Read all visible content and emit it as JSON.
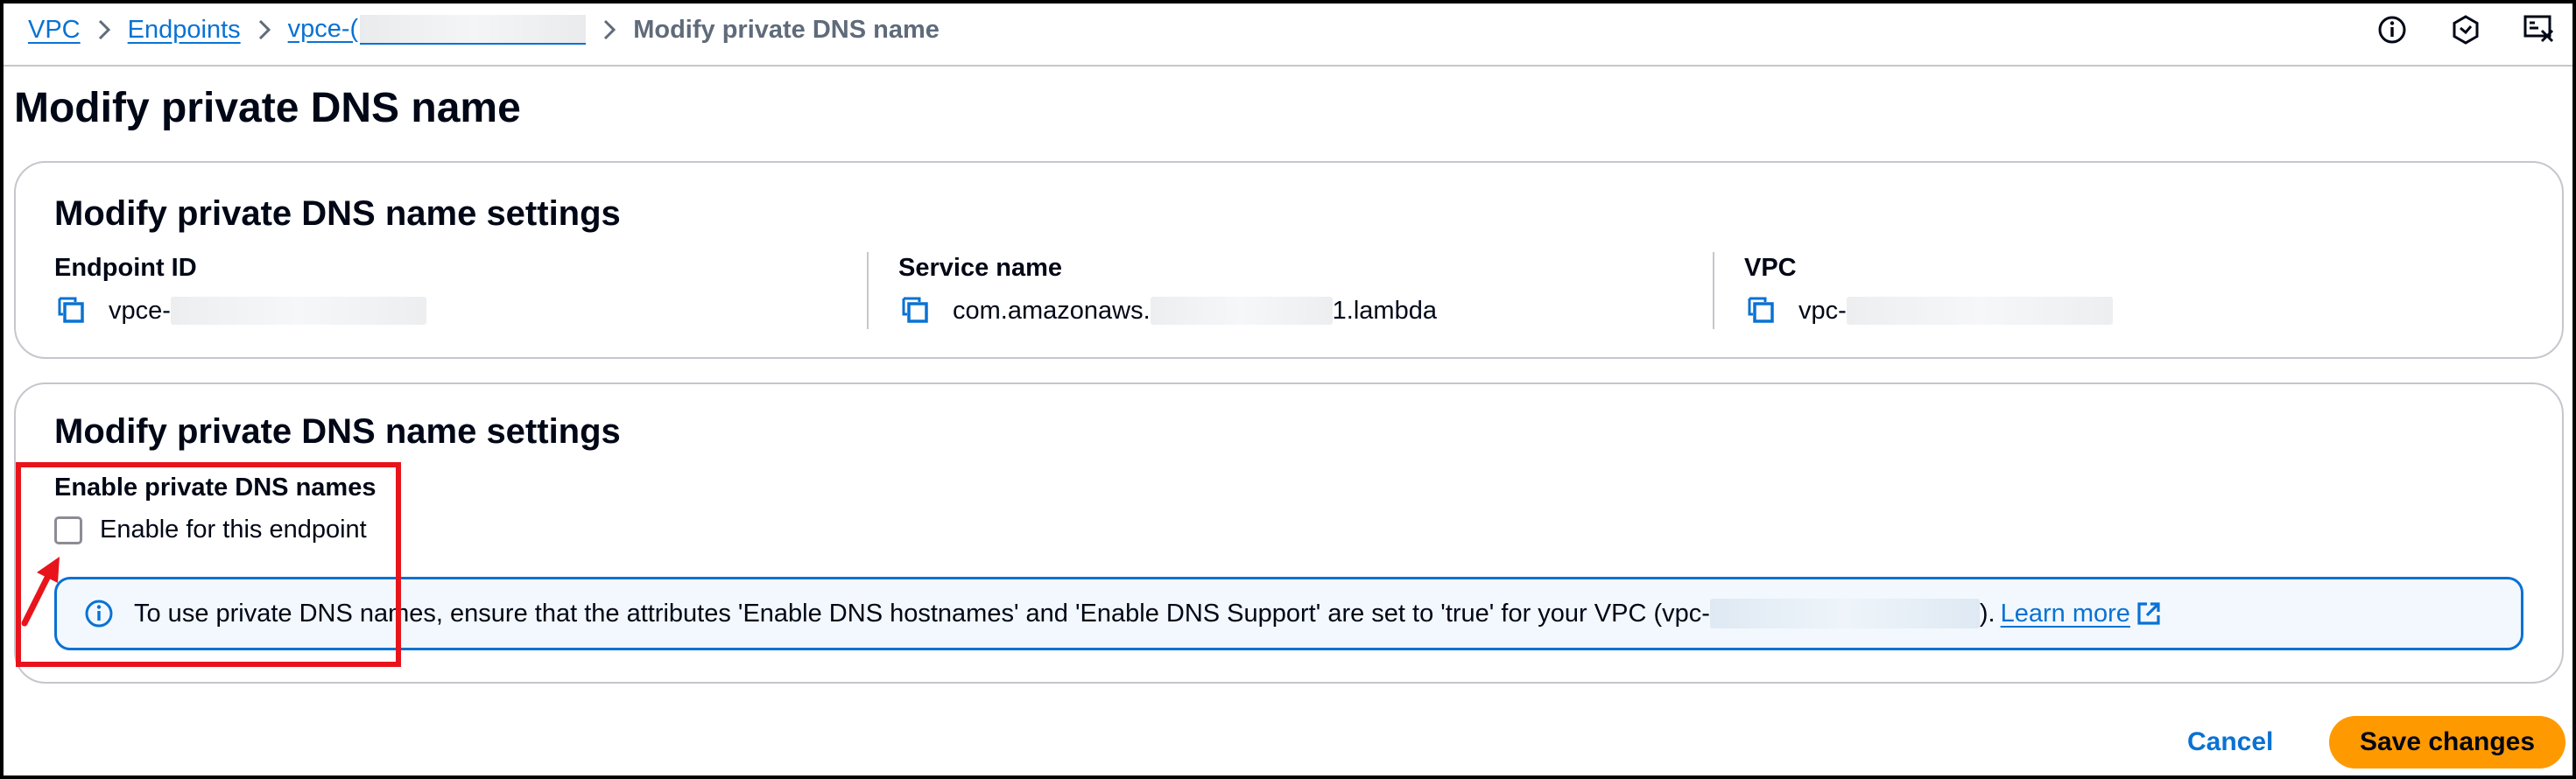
{
  "breadcrumb": {
    "items": [
      "VPC",
      "Endpoints",
      "vpce-("
    ],
    "current": "Modify private DNS name"
  },
  "header_icons": [
    "info-icon",
    "settings-hex-icon",
    "feedback-icon"
  ],
  "page": {
    "title": "Modify private DNS name"
  },
  "details_panel": {
    "title": "Modify private DNS name settings",
    "fields": [
      {
        "label": "Endpoint ID",
        "value_prefix": "vpce-",
        "value_suffix": ""
      },
      {
        "label": "Service name",
        "value_prefix": "com.amazonaws.",
        "value_suffix": "1.lambda"
      },
      {
        "label": "VPC",
        "value_prefix": "vpc-",
        "value_suffix": ""
      }
    ]
  },
  "settings_panel": {
    "title": "Modify private DNS name settings",
    "field_label": "Enable private DNS names",
    "checkbox_label": "Enable for this endpoint",
    "checkbox_checked": false,
    "alert": {
      "text_before": "To use private DNS names, ensure that the attributes 'Enable DNS hostnames' and 'Enable DNS Support' are set to 'true' for your VPC (vpc-",
      "text_after": ").",
      "link": "Learn more"
    }
  },
  "actions": {
    "cancel": "Cancel",
    "save": "Save changes"
  },
  "colors": {
    "link": "#0972d3",
    "primary_button": "#ff9900",
    "annotation": "#e8141c",
    "border": "#c6c6cd"
  }
}
